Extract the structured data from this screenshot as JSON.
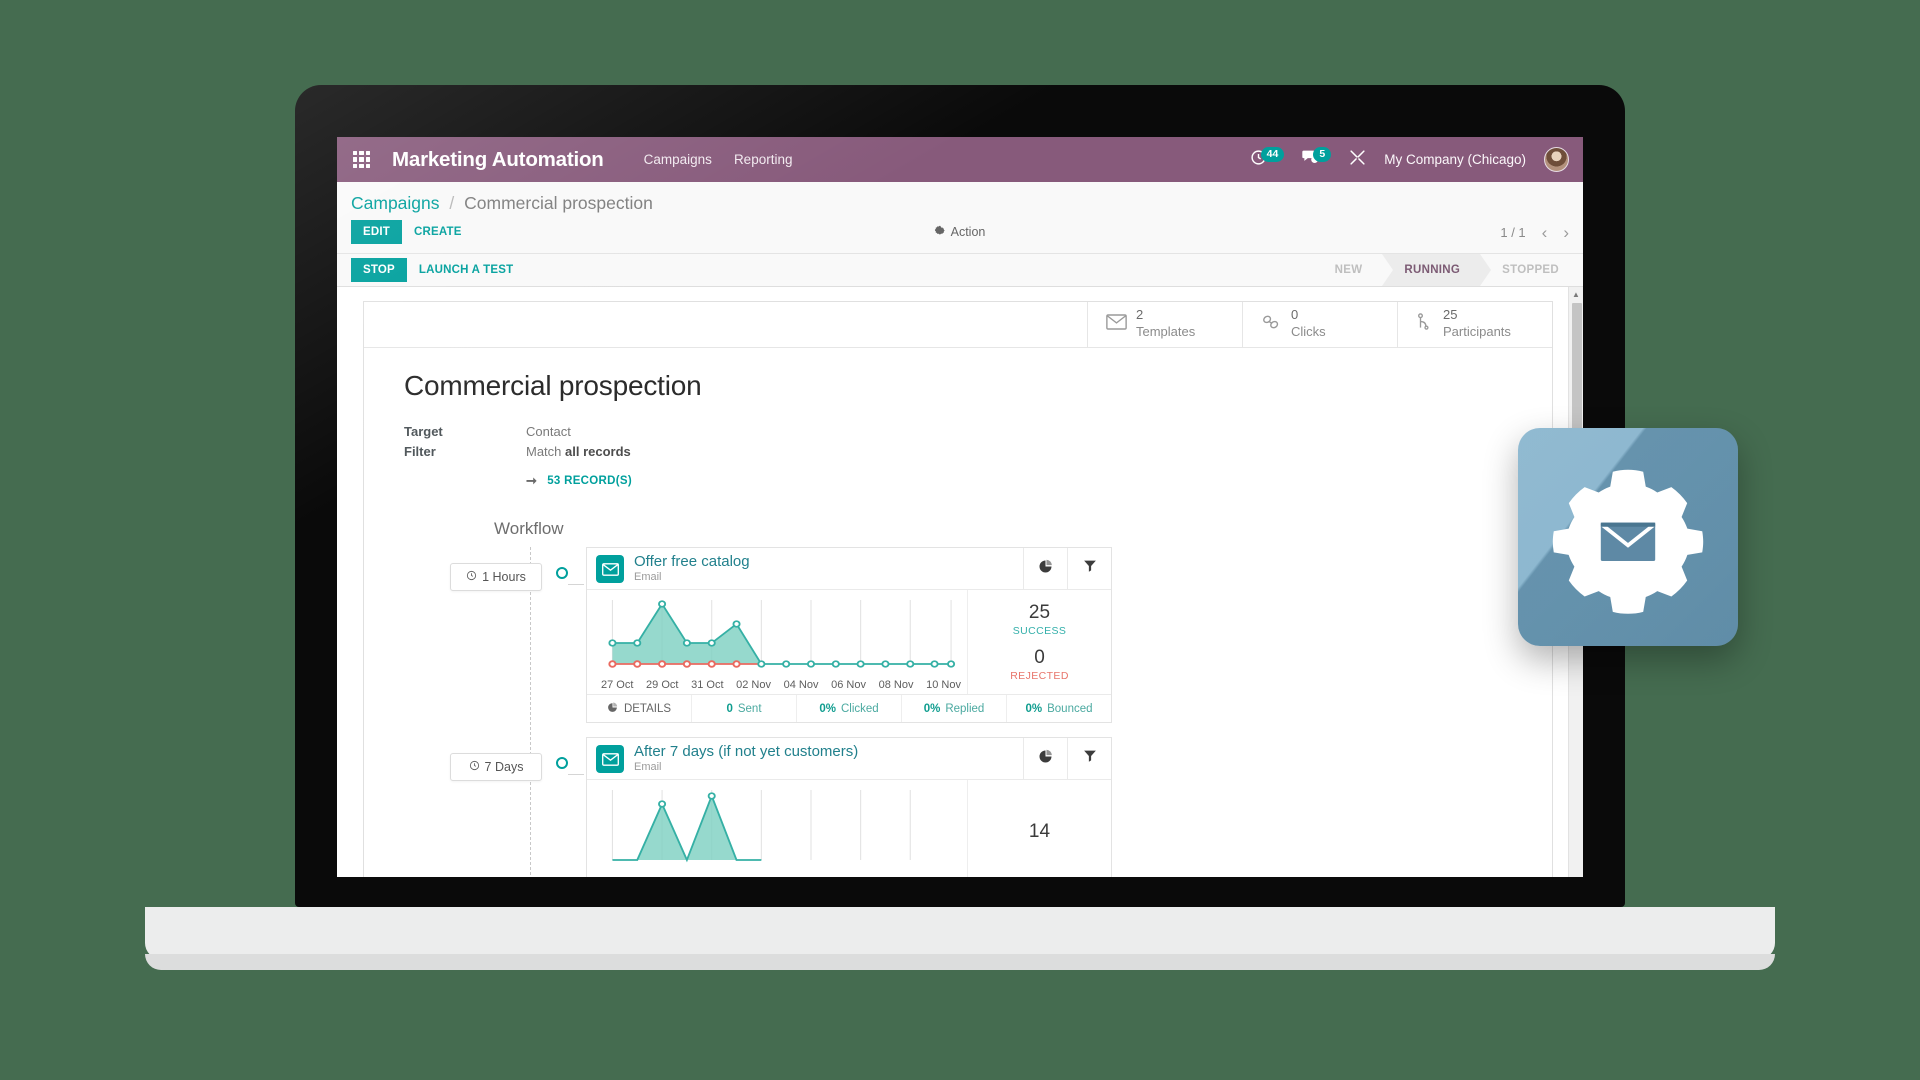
{
  "navbar": {
    "apps_icon": "apps-grid-icon",
    "brand": "Marketing Automation",
    "menu": [
      {
        "label": "Campaigns"
      },
      {
        "label": "Reporting"
      }
    ],
    "activity_icon": "clock-activity-icon",
    "activity_count": "44",
    "messages_icon": "chat-bubble-icon",
    "messages_count": "5",
    "tools_icon": "wrench-screwdriver-icon",
    "company": "My Company (Chicago)",
    "avatar": "user-avatar",
    "bg_color": "#875a7b"
  },
  "control_panel": {
    "breadcrumb_root": "Campaigns",
    "breadcrumb_sep": "/",
    "breadcrumb_current": "Commercial prospection",
    "edit_label": "EDIT",
    "create_label": "CREATE",
    "action_label": "Action",
    "action_icon": "gear-icon",
    "pager_value": "1 / 1",
    "prev_icon": "chevron-left-icon",
    "next_icon": "chevron-right-icon"
  },
  "status_row": {
    "stop_label": "STOP",
    "launch_test_label": "LAUNCH A TEST",
    "statuses": [
      {
        "label": "NEW",
        "active": false
      },
      {
        "label": "RUNNING",
        "active": true
      },
      {
        "label": "STOPPED",
        "active": false
      }
    ]
  },
  "stat_buttons": [
    {
      "icon": "envelope-icon",
      "value": "2",
      "label": "Templates"
    },
    {
      "icon": "link-chain-icon",
      "value": "0",
      "label": "Clicks"
    },
    {
      "icon": "participants-icon",
      "value": "25",
      "label": "Participants"
    }
  ],
  "record": {
    "title": "Commercial prospection",
    "fields": [
      {
        "label": "Target",
        "value": "Contact",
        "bold": ""
      },
      {
        "label": "Filter",
        "value": "Match ",
        "bold": "all records"
      }
    ],
    "records_link": "53 RECORD(S)",
    "records_arrow_icon": "arrow-right-icon"
  },
  "workflow": {
    "title": "Workflow",
    "activities": [
      {
        "delay": "1 Hours",
        "delay_icon": "clock-icon",
        "icon": "envelope-icon",
        "title": "Offer free catalog",
        "subtitle": "Email",
        "stats_icon": "pie-chart-icon",
        "filter_icon": "funnel-icon",
        "kpi_success_value": "25",
        "kpi_success_label": "SUCCESS",
        "kpi_rejected_value": "0",
        "kpi_rejected_label": "REJECTED",
        "footer": [
          {
            "icon": "pie-chart-icon",
            "value": "",
            "label": "DETAILS"
          },
          {
            "value": "0",
            "label": "Sent"
          },
          {
            "value": "0%",
            "label": "Clicked"
          },
          {
            "value": "0%",
            "label": "Replied"
          },
          {
            "value": "0%",
            "label": "Bounced"
          }
        ]
      },
      {
        "delay": "7 Days",
        "delay_icon": "clock-icon",
        "icon": "envelope-icon",
        "title": "After 7 days (if not yet customers)",
        "subtitle": "Email",
        "stats_icon": "pie-chart-icon",
        "filter_icon": "funnel-icon",
        "kpi_success_value": "14",
        "kpi_success_label": "",
        "kpi_rejected_value": "",
        "kpi_rejected_label": "",
        "footer": []
      }
    ]
  },
  "scrollbar": {
    "up_icon": "triangle-up-icon"
  },
  "app_icon": {
    "name": "marketing-automation-app-icon",
    "bg_color": "#7fafca",
    "glyph": "gear-with-envelope"
  },
  "chart_data": [
    {
      "type": "area",
      "title": "Offer free catalog delivery",
      "categories": [
        "27 Oct",
        "28 Oct",
        "29 Oct",
        "30 Oct",
        "31 Oct",
        "01 Nov",
        "02 Nov",
        "03 Nov",
        "04 Nov",
        "05 Nov",
        "06 Nov",
        "07 Nov",
        "08 Nov",
        "09 Nov",
        "10 Nov"
      ],
      "tick_labels": [
        "27 Oct",
        "29 Oct",
        "31 Oct",
        "02 Nov",
        "04 Nov",
        "06 Nov",
        "08 Nov",
        "10 Nov"
      ],
      "series": [
        {
          "name": "Success",
          "color": "#3fb5a5",
          "values": [
            4,
            4,
            12,
            4,
            4,
            8,
            0,
            0,
            0,
            0,
            0,
            0,
            0,
            0,
            0
          ]
        },
        {
          "name": "Rejected",
          "color": "#ea6a60",
          "values": [
            0,
            0,
            0,
            0,
            0,
            0,
            0,
            0,
            0,
            0,
            0,
            0,
            0,
            0,
            0
          ]
        }
      ],
      "ylim": [
        0,
        13
      ],
      "grid": true,
      "legend": "none",
      "xlabel": "",
      "ylabel": ""
    },
    {
      "type": "area",
      "title": "After 7 days (if not yet customers) delivery",
      "categories": [
        "27 Oct",
        "28 Oct",
        "29 Oct",
        "30 Oct",
        "31 Oct",
        "01 Nov",
        "02 Nov",
        "03 Nov",
        "04 Nov",
        "05 Nov",
        "06 Nov",
        "07 Nov",
        "08 Nov",
        "09 Nov",
        "10 Nov"
      ],
      "tick_labels": [],
      "series": [
        {
          "name": "Success",
          "color": "#3fb5a5",
          "values": [
            0,
            0,
            6,
            0,
            7,
            0,
            0,
            0,
            0,
            0,
            0,
            0,
            0,
            0,
            0
          ]
        }
      ],
      "ylim": [
        0,
        13
      ],
      "grid": true,
      "legend": "none",
      "xlabel": "",
      "ylabel": ""
    }
  ]
}
